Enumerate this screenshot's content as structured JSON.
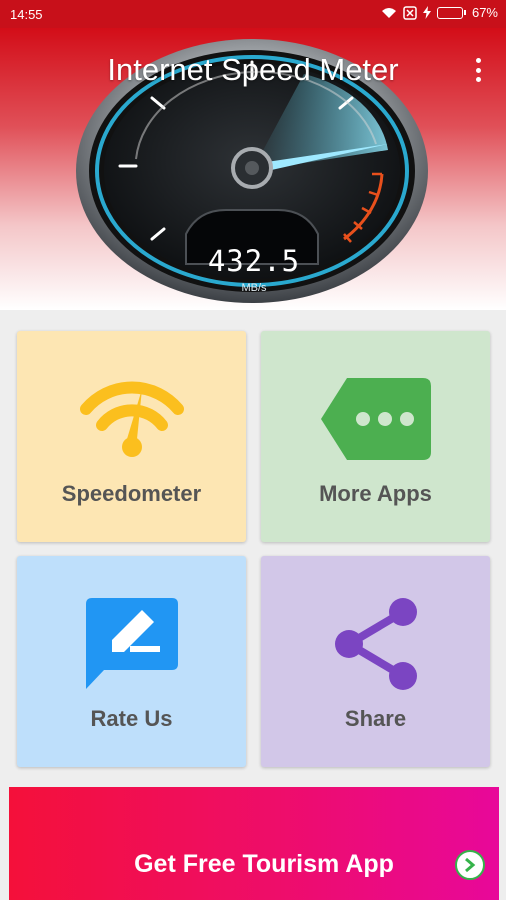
{
  "status": {
    "time": "14:55",
    "battery": "67%",
    "battery_level": 0.67
  },
  "app": {
    "title": "Internet Speed Meter"
  },
  "gauge": {
    "value": "432.5",
    "unit": "MB/s"
  },
  "tiles": [
    {
      "label": "Speedometer",
      "icon": "speedometer-wifi-icon",
      "color": "#fde6b3",
      "icon_color": "#fbbf1e"
    },
    {
      "label": "More Apps",
      "icon": "more-apps-tag-icon",
      "color": "#cfe6cd",
      "icon_color": "#4caf50"
    },
    {
      "label": "Rate Us",
      "icon": "rate-pencil-icon",
      "color": "#bedffb",
      "icon_color": "#2196f3"
    },
    {
      "label": "Share",
      "icon": "share-icon",
      "color": "#d2c7e8",
      "icon_color": "#7b45c2"
    }
  ],
  "banner": {
    "label": "Get Free Tourism App",
    "icon": "chevron-right-circle-icon"
  },
  "colors": {
    "header_red": "#d30d18",
    "banner_start": "#f4103a",
    "banner_end": "#e8089a"
  }
}
